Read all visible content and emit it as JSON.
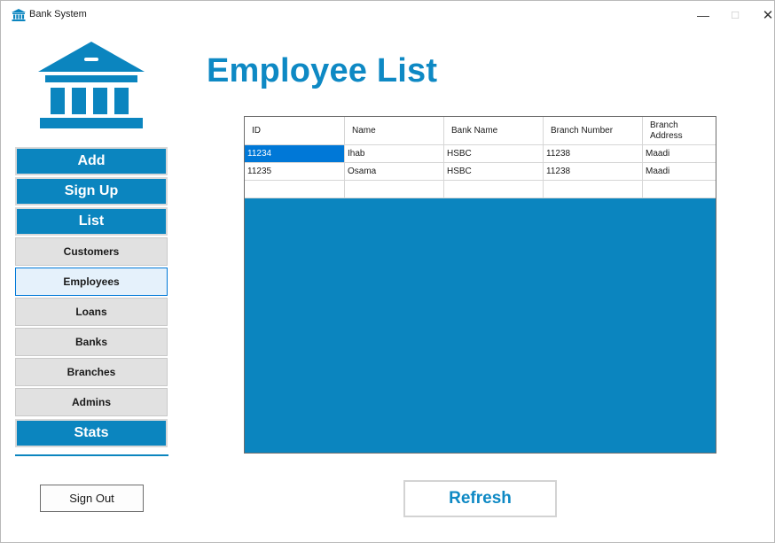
{
  "window": {
    "title": "Bank System",
    "min_glyph": "—",
    "max_glyph": "☐",
    "close_glyph": "✕",
    "icon": "bank-icon"
  },
  "page": {
    "title": "Employee List"
  },
  "colors": {
    "accent": "#0b85bf",
    "title": "#0e89c4",
    "selection": "#0078d7"
  },
  "sidebar": {
    "logo": "bank-building-icon",
    "items": [
      {
        "label": "Add",
        "style": "primary"
      },
      {
        "label": "Sign Up",
        "style": "primary"
      },
      {
        "label": "List",
        "style": "primary"
      },
      {
        "label": "Customers",
        "style": "sub"
      },
      {
        "label": "Employees",
        "style": "selected"
      },
      {
        "label": "Loans",
        "style": "sub"
      },
      {
        "label": "Banks",
        "style": "sub"
      },
      {
        "label": "Branches",
        "style": "sub"
      },
      {
        "label": "Admins",
        "style": "sub"
      },
      {
        "label": "Stats",
        "style": "primary"
      }
    ],
    "sign_out": "Sign Out"
  },
  "grid": {
    "columns": [
      "ID",
      "Name",
      "Bank Name",
      "Branch Number",
      "Branch Address"
    ],
    "rows": [
      [
        "11234",
        "Ihab",
        "HSBC",
        "11238",
        "Maadi"
      ],
      [
        "11235",
        "Osama",
        "HSBC",
        "11238",
        "Maadi"
      ],
      [
        "",
        "",
        "",
        "",
        ""
      ]
    ],
    "selected_cell": "row 0, column ID"
  },
  "actions": {
    "refresh": "Refresh"
  }
}
